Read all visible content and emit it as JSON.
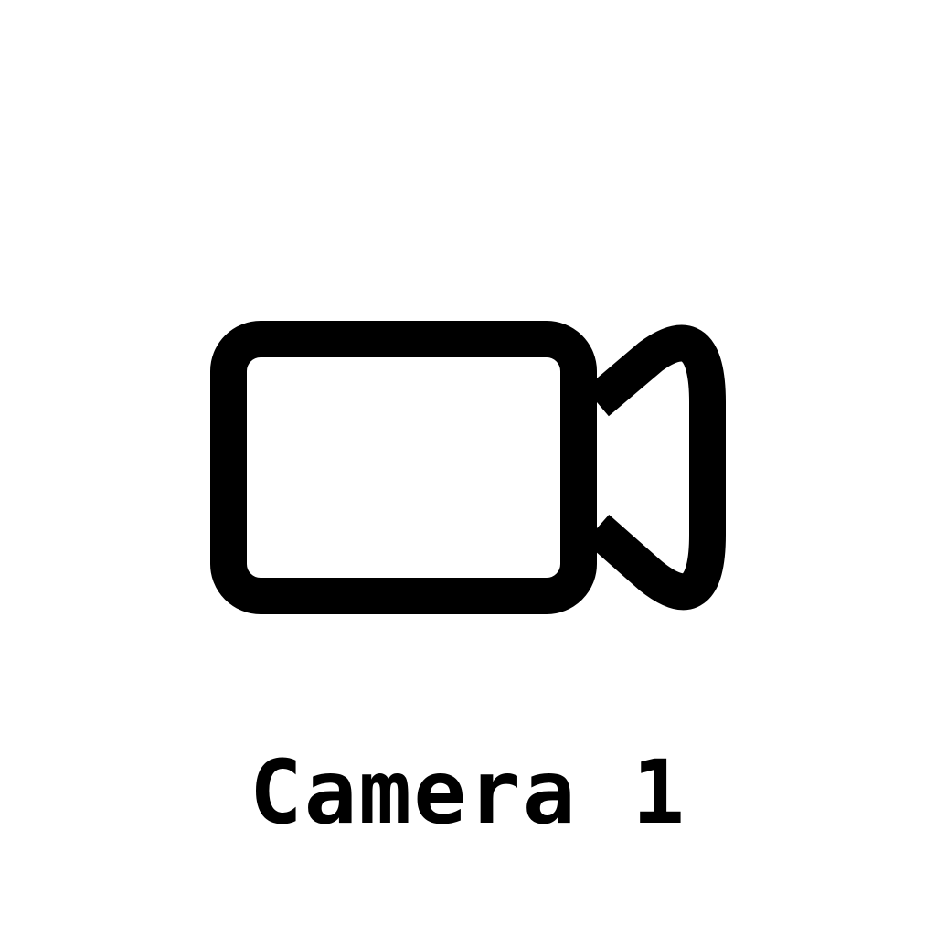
{
  "icon": "video-camera-icon",
  "label": "Camera 1",
  "colors": {
    "foreground": "#000000",
    "background": "#ffffff"
  }
}
